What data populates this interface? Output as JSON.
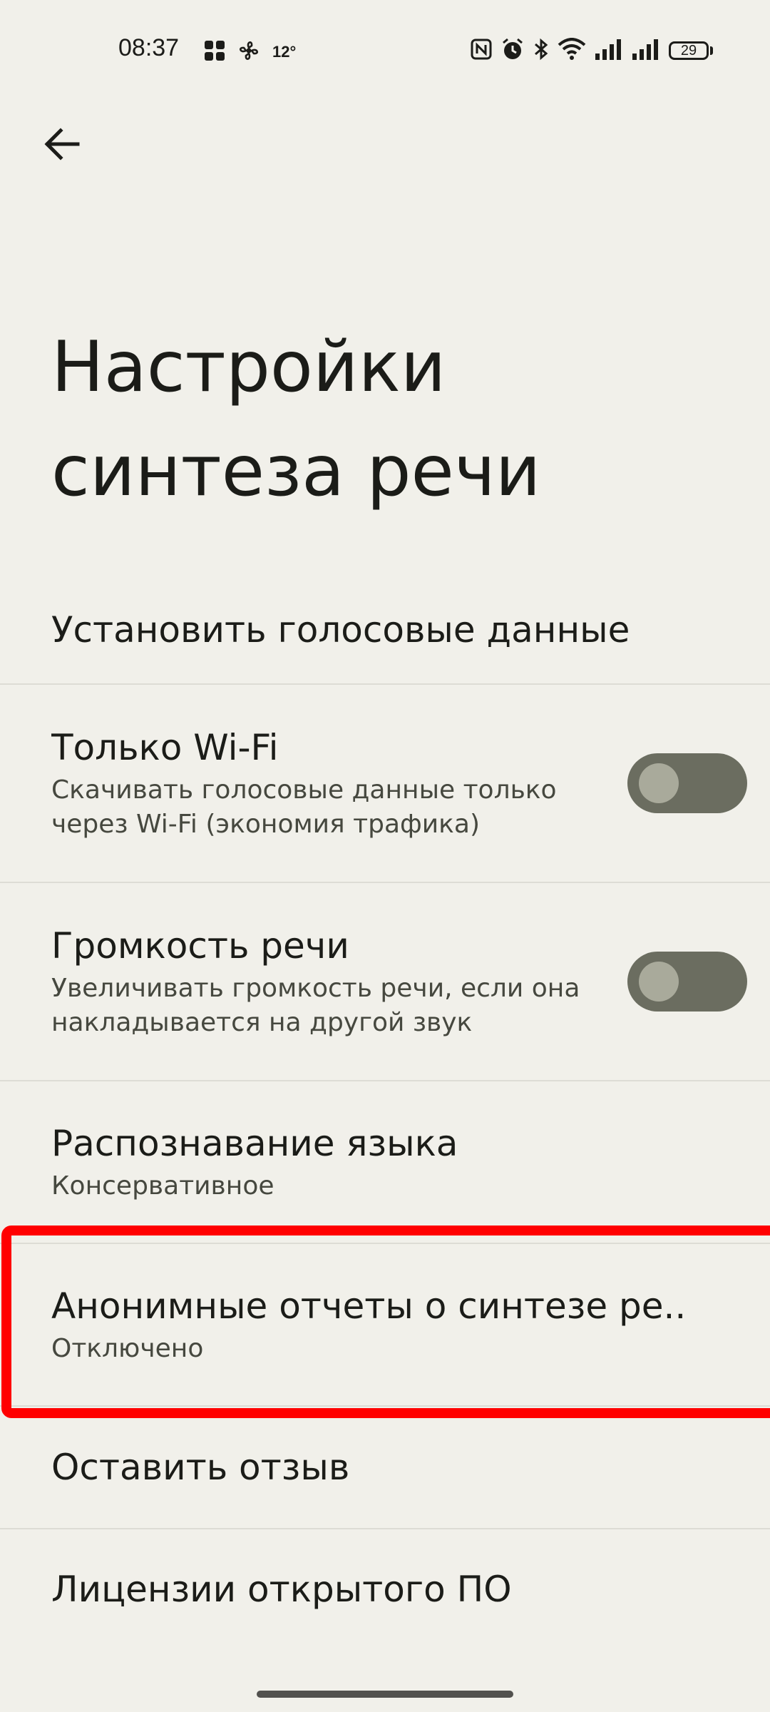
{
  "status_bar": {
    "time": "08:37",
    "temperature": "12°",
    "battery": "29",
    "left_icons": [
      "apps-grid-icon",
      "fan-icon"
    ],
    "right_icons": [
      "nfc-icon",
      "alarm-icon",
      "bluetooth-icon",
      "wifi-icon",
      "signal-icon",
      "signal-icon"
    ]
  },
  "header": {
    "back_icon": "arrow-back-icon",
    "title": "Настройки синтеза речи"
  },
  "settings": [
    {
      "title": "Установить голосовые данные"
    },
    {
      "title": "Только Wi-Fi",
      "summary": "Скачивать голосовые данные только через Wi-Fi (экономия трафика)",
      "toggle": false
    },
    {
      "title": "Громкость речи",
      "summary": "Увеличивать громкость речи, если она накладывается на другой звук",
      "toggle": false
    },
    {
      "title": "Распознавание языка",
      "summary": "Консервативное"
    },
    {
      "title": "Анонимные отчеты о синтезе ре..",
      "summary": "Отключено",
      "highlighted": true
    },
    {
      "title": "Оставить отзыв"
    },
    {
      "title": "Лицензии открытого ПО"
    }
  ],
  "colors": {
    "background": "#f1f0ea",
    "toggle_track": "#6b6d60",
    "highlight": "#ff0000"
  }
}
